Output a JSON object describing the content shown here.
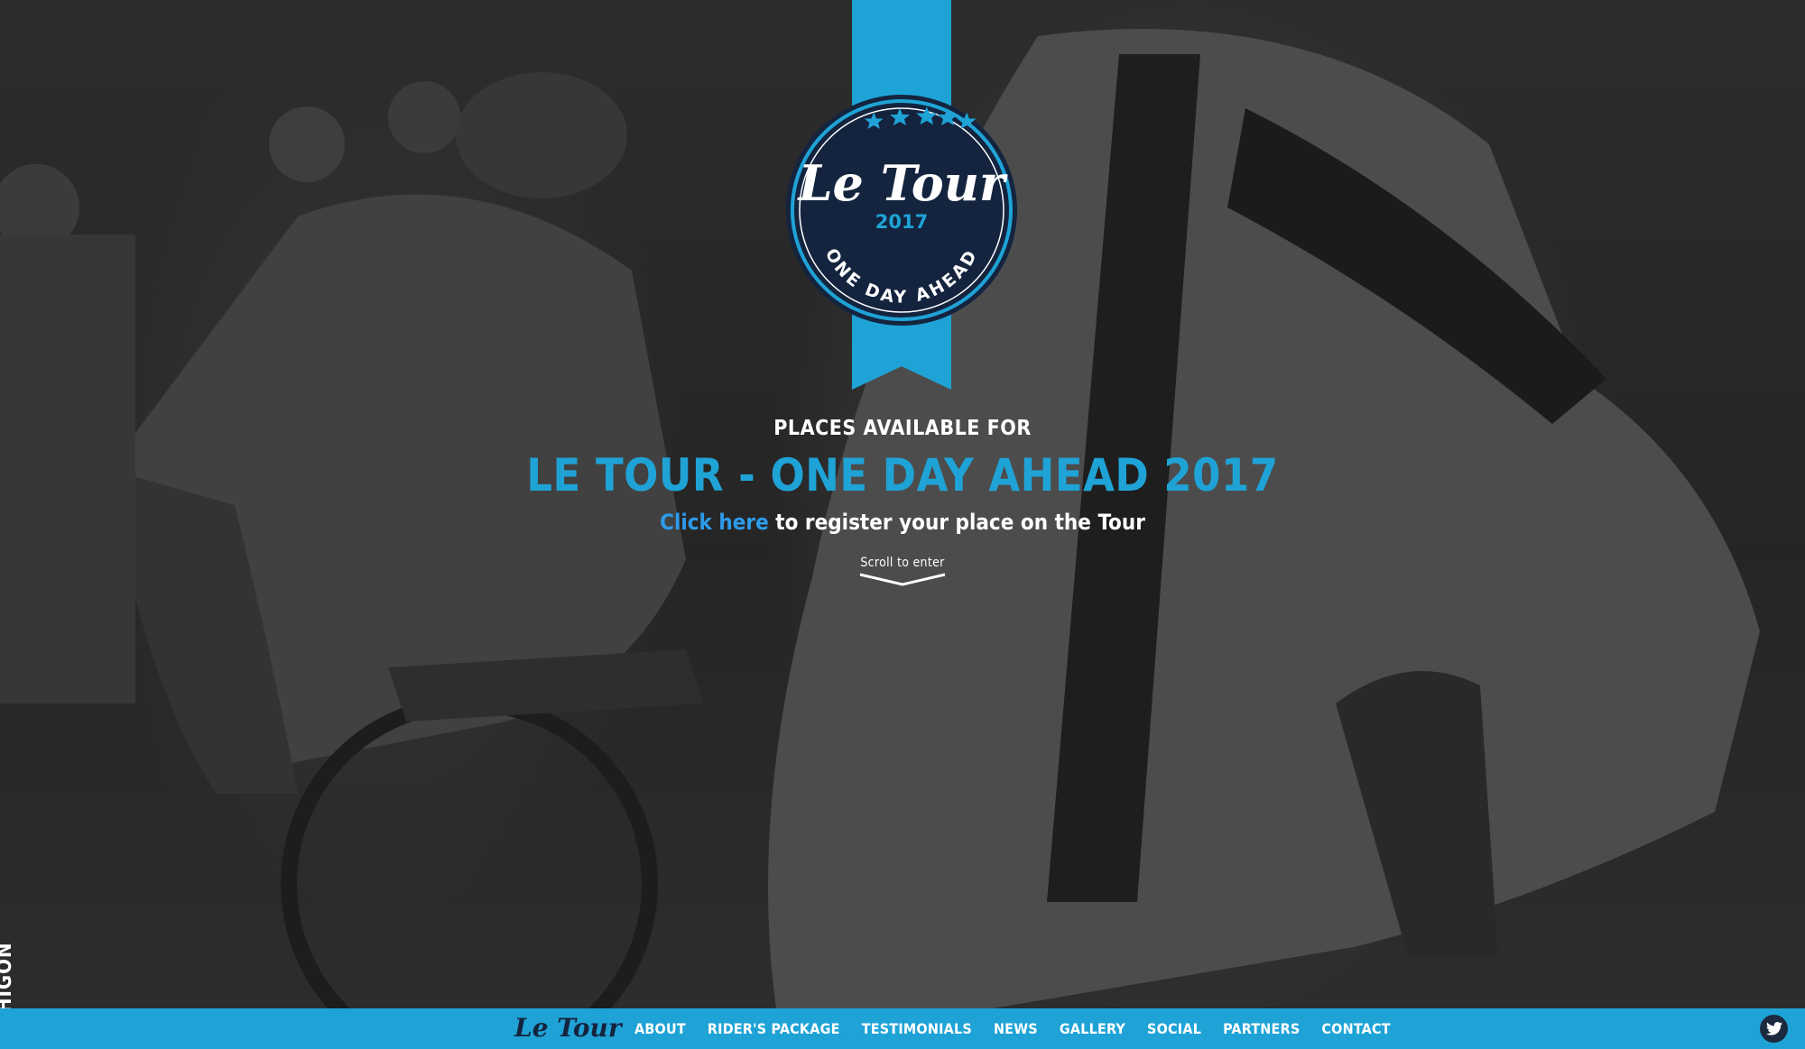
{
  "hero": {
    "logo": {
      "script_text": "Le Tour",
      "year": "2017",
      "arc_text": "ONE DAY AHEAD",
      "stars": 5
    },
    "kicker": "PLACES AVAILABLE FOR",
    "title": "LE TOUR - ONE DAY AHEAD 2017",
    "cta_link": "Click here",
    "cta_rest": " to register your place on the Tour",
    "scroll_label": "Scroll to enter"
  },
  "side_tag": "HIGON",
  "nav": {
    "logo_text": "Le Tour",
    "items": [
      "ABOUT",
      "RIDER'S PACKAGE",
      "TESTIMONIALS",
      "NEWS",
      "GALLERY",
      "SOCIAL",
      "PARTNERS",
      "CONTACT"
    ],
    "twitter_icon": "twitter-icon"
  },
  "colors": {
    "accent": "#1fa3d6",
    "badge_navy": "#14243f",
    "link": "#2e9bea"
  }
}
